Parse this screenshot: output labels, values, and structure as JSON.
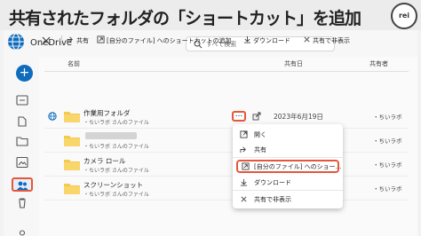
{
  "headline": {
    "text": "共有されたフォルダの「ショートカット」を追加",
    "logo_text": "rei"
  },
  "app": {
    "title": "OneDrive",
    "search_placeholder": "すべて検索"
  },
  "toolbar": {
    "copy_link": "共有",
    "add_shortcut": "[自分のファイル] へのショートカットの追加",
    "download": "ダウンロード",
    "hide_shared": "共有で非表示"
  },
  "columns": {
    "name": "名前",
    "shared_date": "共有日",
    "owner": "共有者"
  },
  "files": [
    {
      "name": "作業用フォルダ",
      "subtitle": "・ちいラボ さんのファイル",
      "shared_date": "2023年6月19日",
      "owner": "・ちいラボ"
    },
    {
      "name": "",
      "subtitle": "・ちいラボ さんのファイル",
      "shared_date": "",
      "owner": "・ちいラボ"
    },
    {
      "name": "カメラ ロール",
      "subtitle": "・ちいラボ さんのファイル",
      "shared_date": "",
      "owner": "・ちいラボ"
    },
    {
      "name": "スクリーンショット",
      "subtitle": "・ちいラボ さんのファイル",
      "shared_date": "",
      "owner": "・ちいラボ"
    }
  ],
  "more_button": "...",
  "context_menu": {
    "open": "開く",
    "share": "共有",
    "add_shortcut": "[自分のファイル] へのショー...",
    "download": "ダウンロード",
    "hide_shared": "共有で非表示"
  },
  "colors": {
    "accent": "#0f6cbd",
    "highlight": "#e4573a",
    "folder": "#f4c94f"
  }
}
